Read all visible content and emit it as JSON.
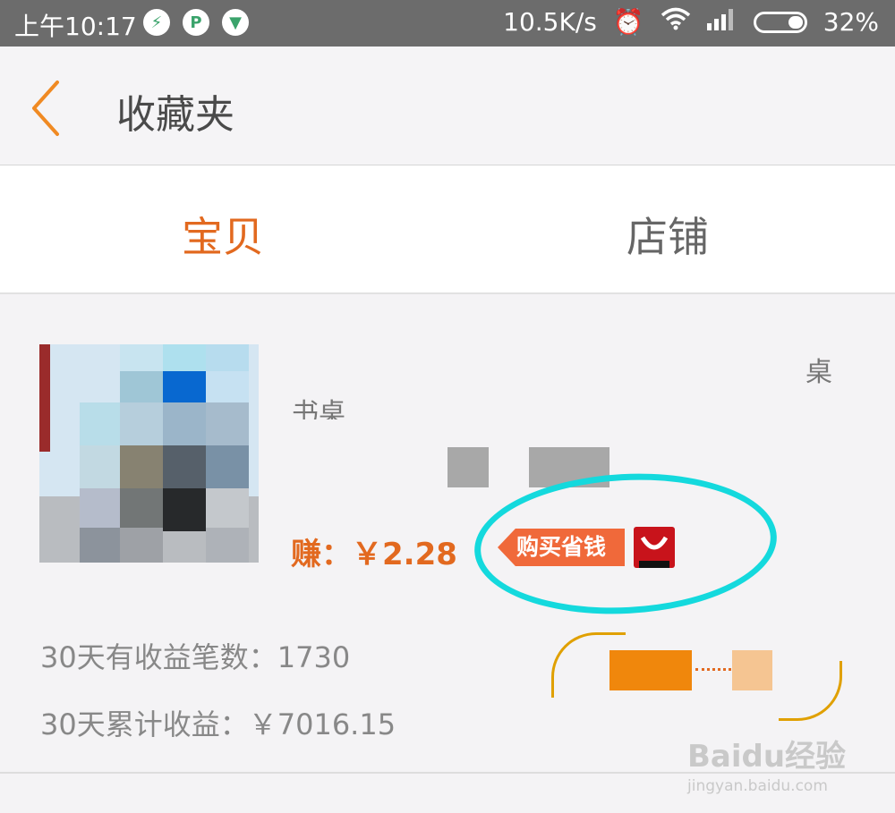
{
  "status_bar": {
    "time": "上午10:17",
    "net_speed": "10.5K/s",
    "battery": "32%",
    "icons": [
      "shield-icon",
      "p-app-icon",
      "vpn-shield-icon",
      "alarm-icon",
      "wifi-icon",
      "signal-icon",
      "battery-icon"
    ]
  },
  "header": {
    "title": "收藏夹",
    "back_icon": "chevron-left-icon"
  },
  "tabs": [
    {
      "label": "宝贝",
      "active": true
    },
    {
      "label": "店铺",
      "active": false
    }
  ],
  "item": {
    "title_fragments": [
      "桌",
      "书桌"
    ],
    "earn_label": "赚：",
    "earn_value": "￥2.28",
    "tag_label": "购买省钱",
    "stats": [
      {
        "label": "30天有收益笔数：",
        "value": "1730"
      },
      {
        "label": "30天累计收益：",
        "value": "￥7016.15"
      }
    ]
  },
  "watermark": {
    "brand": "Baidu经验",
    "url": "jingyan.baidu.com"
  },
  "colors": {
    "accent": "#e2691f",
    "highlight_circle": "#14d9dd",
    "status_bar": "#6c6c6c"
  }
}
